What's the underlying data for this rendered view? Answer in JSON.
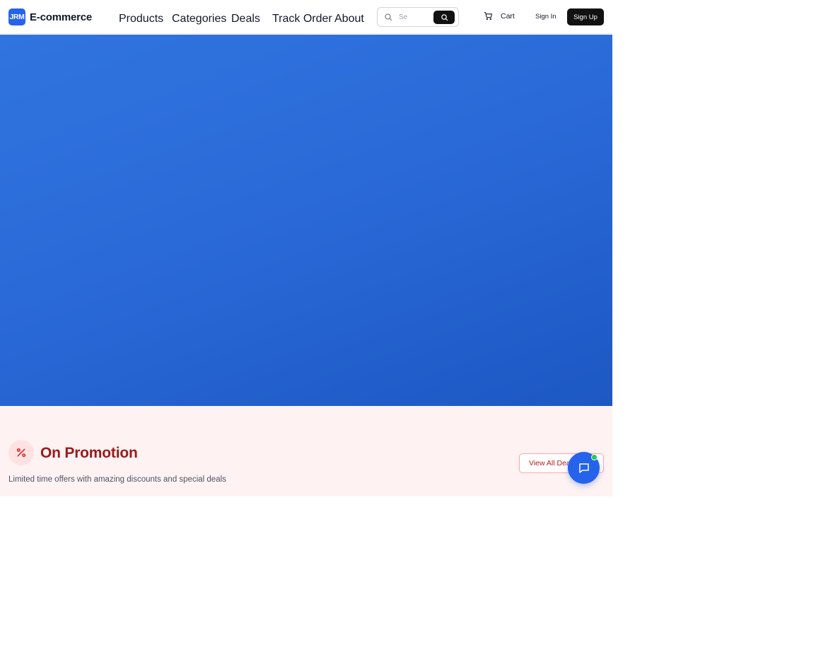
{
  "brand": {
    "logo_mark": "JRM",
    "name": "E-commerce",
    "accent": "#2563eb"
  },
  "nav": {
    "items": [
      "Products",
      "Categories",
      "Deals",
      "Track Order",
      "About"
    ]
  },
  "search": {
    "placeholder": "Se",
    "icon": "search-icon",
    "button_icon": "search-icon"
  },
  "header_actions": {
    "cart_label": "Cart",
    "cart_icon": "cart-icon",
    "sign_in": "Sign In",
    "sign_up": "Sign Up"
  },
  "hero": {
    "background": "#2a6ad8"
  },
  "promotion": {
    "icon": "percent-icon",
    "title": "On Promotion",
    "subtitle": "Limited time offers with amazing discounts and special deals",
    "view_all": "View All Deals",
    "title_color": "#991b1b",
    "background": "#fef2f2"
  },
  "chat": {
    "icon": "chat-icon",
    "status_color": "#22c55e"
  }
}
